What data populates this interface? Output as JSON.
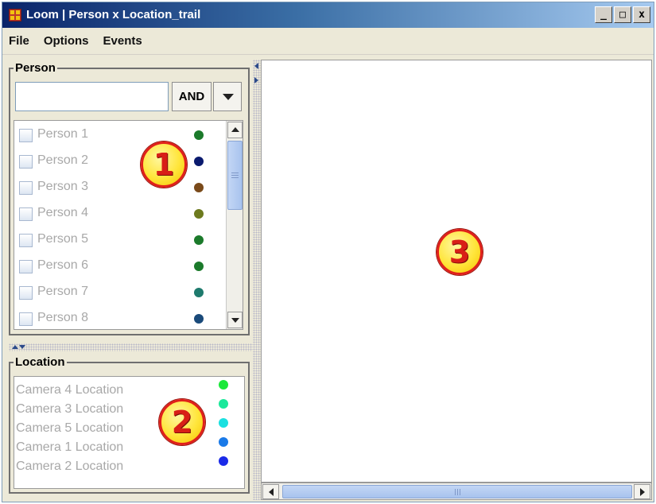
{
  "window": {
    "title": "Loom | Person x Location_trail",
    "controls": {
      "minimize": "_",
      "maximize": "□",
      "close": "x"
    }
  },
  "menu": {
    "items": [
      {
        "label": "File"
      },
      {
        "label": "Options"
      },
      {
        "label": "Events"
      }
    ]
  },
  "person_panel": {
    "title": "Person",
    "search_value": "",
    "operator": "AND",
    "items": [
      {
        "label": "Person 1",
        "color": "#1b7a2b"
      },
      {
        "label": "Person 2",
        "color": "#0a1a6e"
      },
      {
        "label": "Person 3",
        "color": "#7a4a1a"
      },
      {
        "label": "Person 4",
        "color": "#6d7a1e"
      },
      {
        "label": "Person 5",
        "color": "#1b7a2b"
      },
      {
        "label": "Person 6",
        "color": "#1b7a2b"
      },
      {
        "label": "Person 7",
        "color": "#1e7a6d"
      },
      {
        "label": "Person 8",
        "color": "#1a4a7a"
      }
    ]
  },
  "location_panel": {
    "title": "Location",
    "items": [
      {
        "label": "Camera 4 Location",
        "color": "#1be83a"
      },
      {
        "label": "Camera 3 Location",
        "color": "#1be89a"
      },
      {
        "label": "Camera 5 Location",
        "color": "#1be0e0"
      },
      {
        "label": "Camera 1 Location",
        "color": "#1a7ae8"
      },
      {
        "label": "Camera 2 Location",
        "color": "#1a2ae8"
      }
    ]
  },
  "callouts": [
    {
      "label": "1"
    },
    {
      "label": "2"
    },
    {
      "label": "3"
    }
  ],
  "colors": {
    "titlebar_start": "#0a246a",
    "titlebar_end": "#a6caf0",
    "callout_fill": "#ffe53a",
    "callout_border": "#e0201a",
    "disabled_text": "#a8a8a8"
  }
}
